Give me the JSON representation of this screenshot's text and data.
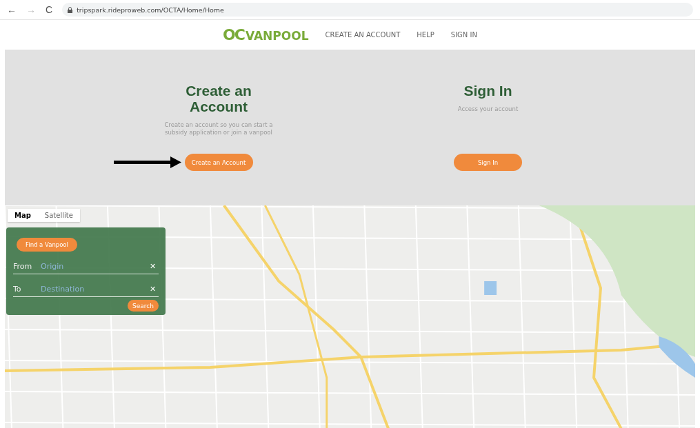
{
  "browser": {
    "back": "←",
    "forward": "→",
    "reload": "C",
    "url": "tripspark.rideproweb.com/OCTA/Home/Home"
  },
  "header": {
    "logo_mark": "OC",
    "logo_text": "VANPOOL",
    "nav": [
      "CREATE AN ACCOUNT",
      "HELP",
      "SIGN IN"
    ]
  },
  "hero": {
    "cards": [
      {
        "title": "Create an Account",
        "text": "Create an account so you can start a subsidy application or join a vanpool",
        "button": "Create an Account",
        "pointer_arrow": true
      },
      {
        "title": "Sign In",
        "text": "Access your account",
        "button": "Sign In",
        "pointer_arrow": false
      }
    ]
  },
  "map": {
    "tabs": [
      {
        "label": "Map",
        "selected": true
      },
      {
        "label": "Satellite",
        "selected": false
      }
    ],
    "panel": {
      "find_button": "Find a Vanpool",
      "fields": [
        {
          "label": "From",
          "placeholder": "Origin",
          "clear": "✕"
        },
        {
          "label": "To",
          "placeholder": "Destination",
          "clear": "✕"
        }
      ],
      "search_button": "Search"
    }
  }
}
